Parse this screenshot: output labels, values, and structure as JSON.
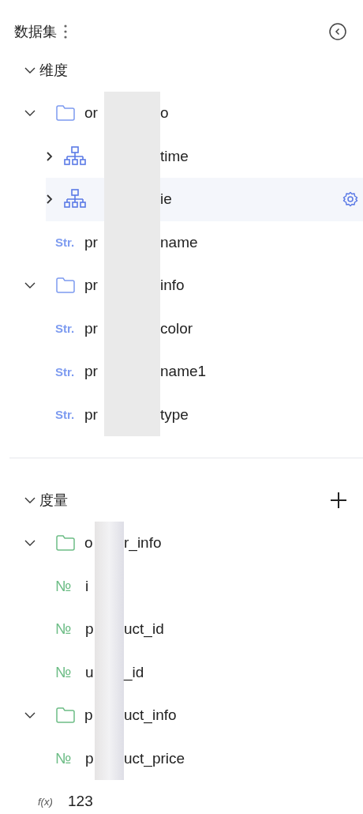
{
  "header": {
    "title": "数据集"
  },
  "sections": [
    {
      "kind": "dimension",
      "title": "维度",
      "expanded": true,
      "add_button": false,
      "items": [
        {
          "kind": "folder",
          "expanded": true,
          "selected": false,
          "name_start": "or",
          "name_end": "o",
          "children": [
            {
              "kind": "hierarchy",
              "expanded": false,
              "selected": false,
              "name_end": "time"
            },
            {
              "kind": "hierarchy",
              "expanded": false,
              "selected": true,
              "name_end": "ie"
            }
          ]
        },
        {
          "kind": "string",
          "type_label": "Str.",
          "selected": false,
          "name_start": "pr",
          "name_end": "name"
        },
        {
          "kind": "folder",
          "expanded": true,
          "selected": false,
          "name_start": "pr",
          "name_end": "info",
          "children": [
            {
              "kind": "string",
              "type_label": "Str.",
              "selected": false,
              "name_start": "pr",
              "name_end": "color"
            },
            {
              "kind": "string",
              "type_label": "Str.",
              "selected": false,
              "name_start": "pr",
              "name_end": "name1"
            },
            {
              "kind": "string",
              "type_label": "Str.",
              "selected": false,
              "name_start": "pr",
              "name_end": "type"
            }
          ]
        }
      ]
    },
    {
      "kind": "measure",
      "title": "度量",
      "expanded": true,
      "add_button": true,
      "items": [
        {
          "kind": "folder",
          "expanded": true,
          "selected": false,
          "name_start": "o",
          "name_end": "r_info",
          "children": [
            {
              "kind": "number",
              "type_label": "№",
              "selected": false,
              "name_start": "i"
            },
            {
              "kind": "number",
              "type_label": "№",
              "selected": false,
              "name_start": "p",
              "name_end": "uct_id"
            },
            {
              "kind": "number",
              "type_label": "№",
              "selected": false,
              "name_start": "u",
              "name_end": "_id"
            }
          ]
        },
        {
          "kind": "folder",
          "expanded": true,
          "selected": false,
          "name_start": "p",
          "name_end": "uct_info",
          "children": [
            {
              "kind": "number",
              "type_label": "№",
              "selected": false,
              "name_start": "p",
              "name_end": "uct_price"
            }
          ]
        },
        {
          "kind": "formula",
          "type_label": "f(x)",
          "selected": false,
          "name_start": "123"
        }
      ]
    }
  ]
}
